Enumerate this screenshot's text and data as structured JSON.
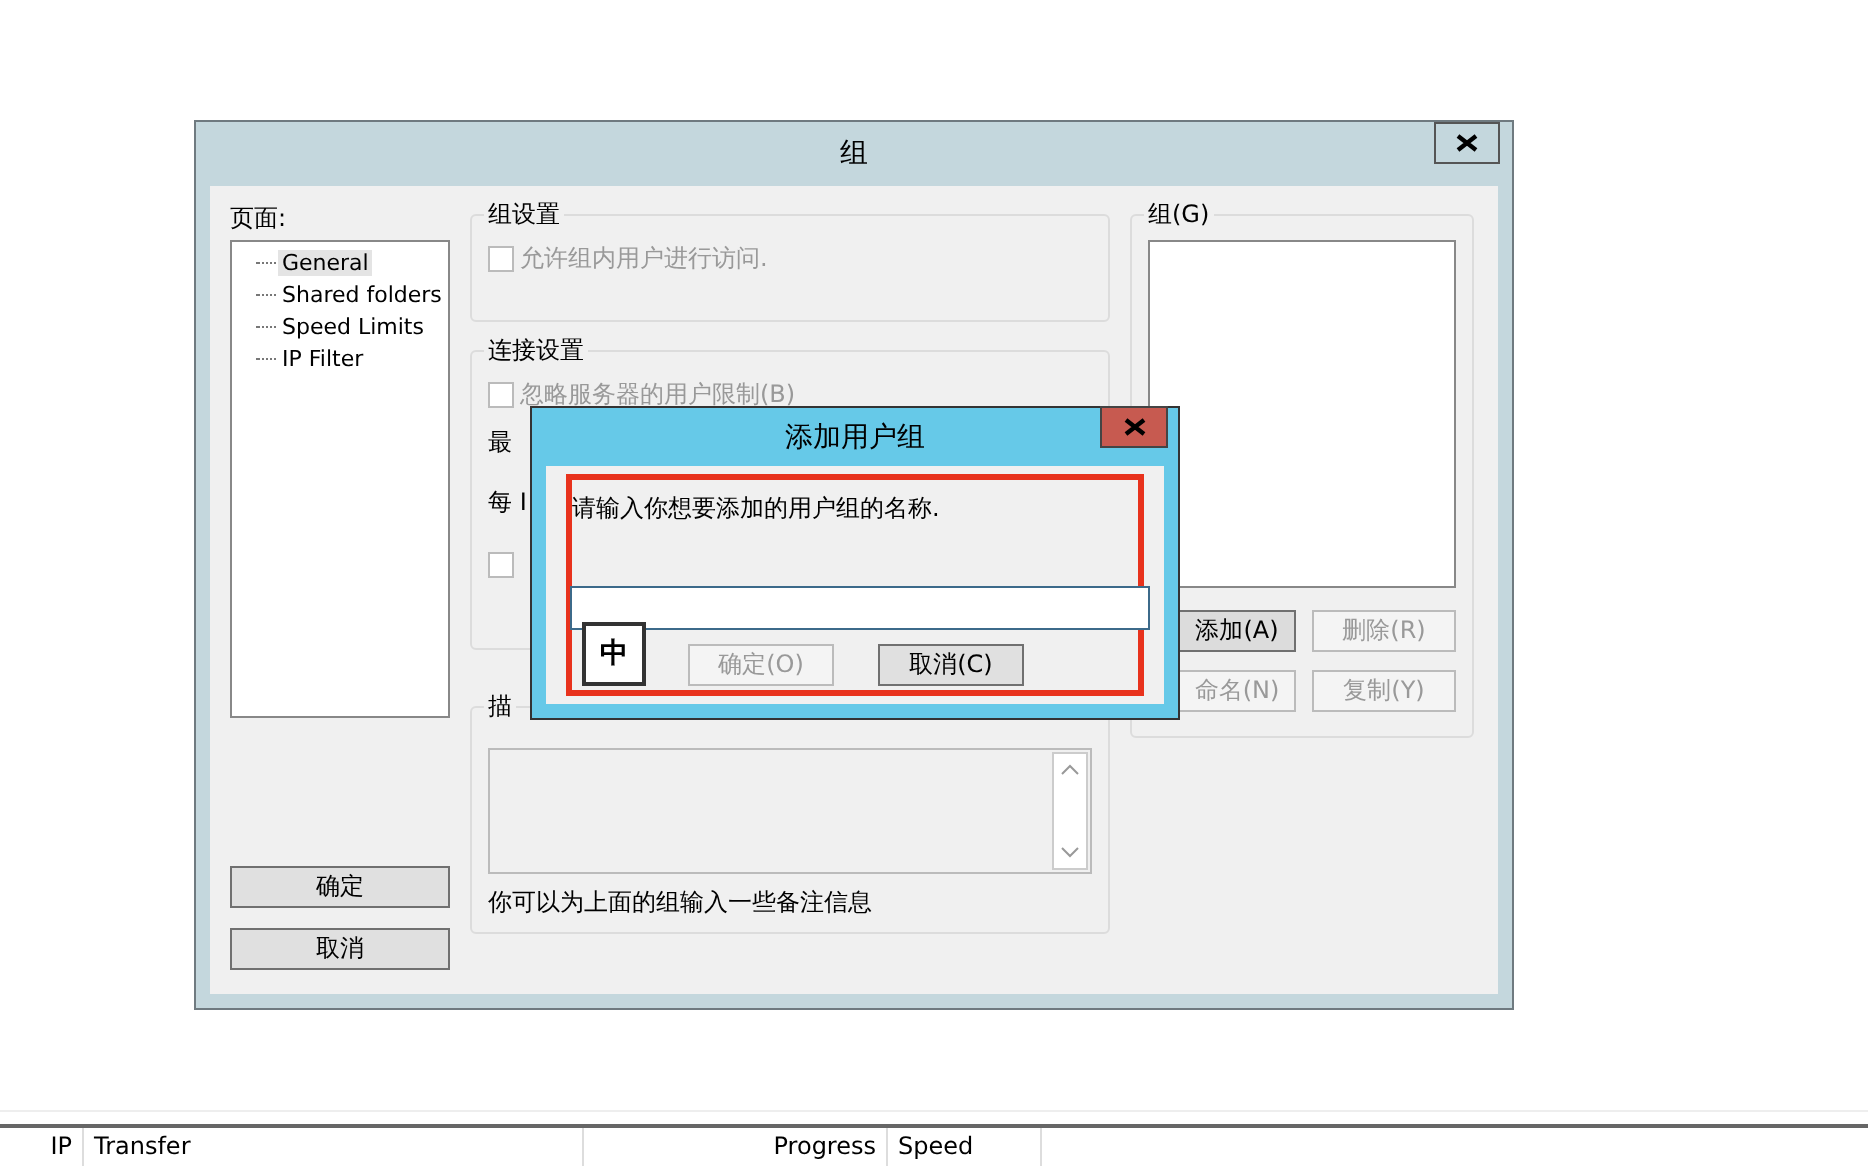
{
  "window": {
    "title": "组"
  },
  "pages": {
    "label": "页面:",
    "items": [
      {
        "label": "General",
        "selected": true
      },
      {
        "label": "Shared folders",
        "selected": false
      },
      {
        "label": "Speed Limits",
        "selected": false
      },
      {
        "label": "IP Filter",
        "selected": false
      }
    ]
  },
  "group_settings": {
    "title": "组设置",
    "option": {
      "label": "允许组内用户进行访问.",
      "checked": false,
      "disabled": true
    }
  },
  "connection_settings": {
    "title": "连接设置",
    "option": {
      "label": "忽略服务器的用户限制(B)",
      "checked": false,
      "disabled": true
    },
    "row_1": "最",
    "row_2": "每 I",
    "option_2": {
      "checked": false,
      "disabled": true
    }
  },
  "description": {
    "title": "描",
    "hint": "你可以为上面的组输入一些备注信息"
  },
  "groups": {
    "title": "组(G)",
    "buttons": [
      {
        "label": "添加(A)",
        "disabled": false
      },
      {
        "label": "删除(R)",
        "disabled": true
      },
      {
        "label": "命名(N)",
        "disabled": true
      },
      {
        "label": "复制(Y)",
        "disabled": true
      }
    ]
  },
  "buttons": [
    {
      "label": "确定"
    },
    {
      "label": "取消"
    }
  ],
  "dialog": {
    "title": "添加用户组",
    "prompt": "请输入你想要添加的用户组的名称.",
    "ime": "中",
    "buttons": [
      {
        "label": "确定(O)",
        "disabled": true
      },
      {
        "label": "取消(C)",
        "disabled": false
      }
    ]
  },
  "transfer_list": {
    "columns": [
      "IP",
      "Transfer",
      "Progress",
      "Speed"
    ]
  }
}
